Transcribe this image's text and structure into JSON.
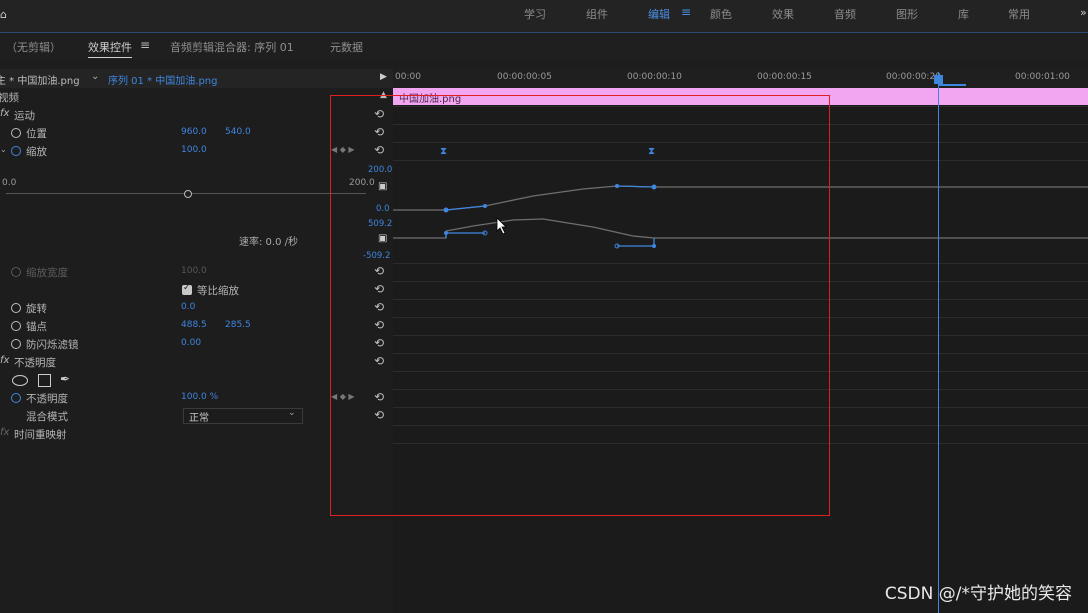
{
  "workspaces": [
    "学习",
    "组件",
    "编辑",
    "颜色",
    "效果",
    "音频",
    "图形",
    "库",
    "常用"
  ],
  "active_workspace": "编辑",
  "panel_tabs": {
    "no_clip": "（无剪辑）",
    "effect_controls": "效果控件",
    "audio_mixer": "音频剪辑混合器: 序列 01",
    "metadata": "元数据"
  },
  "source": {
    "master": "主 * 中国加油.png",
    "sequence": "序列 01 * 中国加油.png"
  },
  "ruler": [
    "00:00",
    "00:00:00:05",
    "00:00:00:10",
    "00:00:00:15",
    "00:00:00:20",
    "00:00:01:00"
  ],
  "clip_name": "中国加油.png",
  "sections": {
    "video": "视频",
    "motion": "运动",
    "opacity_group": "不透明度",
    "time_remap": "时间重映射"
  },
  "properties": {
    "position": {
      "label": "位置",
      "x": "960.0",
      "y": "540.0"
    },
    "scale": {
      "label": "缩放",
      "value": "100.0"
    },
    "scale_width": {
      "label": "缩放宽度",
      "value": "100.0"
    },
    "uniform_scale": {
      "label": "等比缩放",
      "checked": true
    },
    "rotation": {
      "label": "旋转",
      "value": "0.0"
    },
    "anchor": {
      "label": "锚点",
      "x": "488.5",
      "y": "285.5"
    },
    "antiflicker": {
      "label": "防闪烁滤镜",
      "value": "0.00"
    },
    "opacity": {
      "label": "不透明度",
      "value": "100.0 %"
    },
    "blend_mode": {
      "label": "混合模式",
      "value": "正常"
    }
  },
  "scale_graph": {
    "slider_min": "0.0",
    "slider_max": "200.0",
    "value_top": "200.0",
    "value_bottom": "0.0",
    "velocity_top": "509.2",
    "velocity_bottom": "-509.2",
    "velocity_label": "速率: 0.0 /秒"
  },
  "watermark": "CSDN @/*守护她的笑容"
}
